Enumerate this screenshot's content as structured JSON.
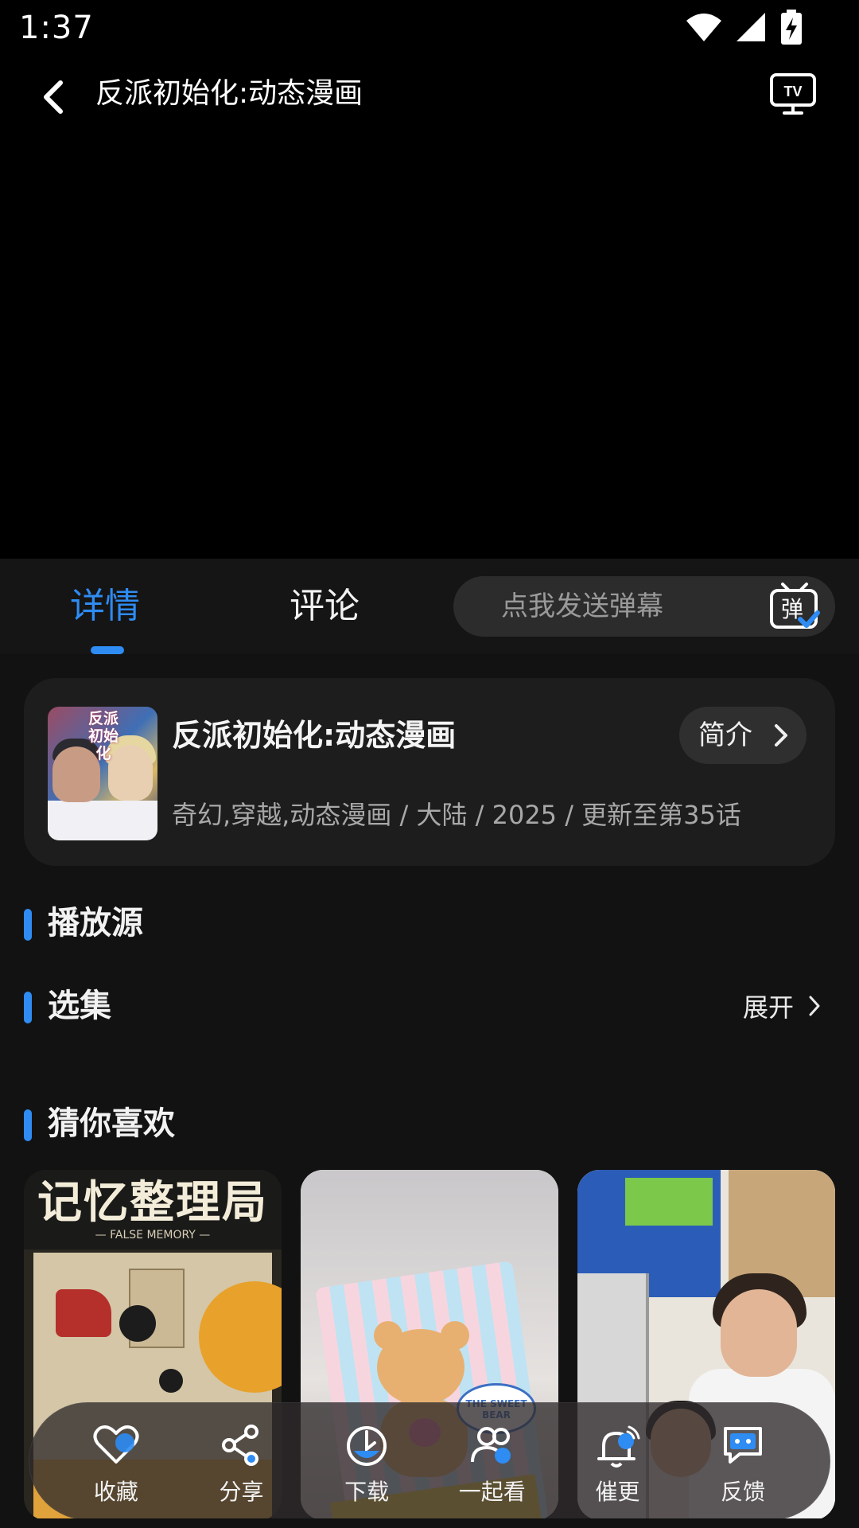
{
  "status_bar": {
    "time": "1:37"
  },
  "player": {
    "title": "反派初始化:动态漫画"
  },
  "tabs": [
    {
      "label": "详情",
      "active": true
    },
    {
      "label": "评论",
      "active": false
    }
  ],
  "danmaku": {
    "placeholder": "点我发送弹幕",
    "icon_text": "弹"
  },
  "info_card": {
    "poster_text": "反派初始化",
    "title": "反派初始化:动态漫画",
    "intro_button": "简介",
    "meta": "奇幻,穿越,动态漫画 / 大陆 / 2025 / 更新至第35话"
  },
  "sections": {
    "source": "播放源",
    "episodes": "选集",
    "expand": "展开",
    "recommend": "猜你喜欢"
  },
  "recommend": [
    {
      "cover_title": "记忆整理局",
      "cover_subtitle": "— FALSE MEMORY —"
    },
    {
      "cover_label": "THE SWEET BEAR"
    },
    {
      "cover_label": ""
    }
  ],
  "actions": [
    {
      "label": "收藏",
      "icon": "heart-icon"
    },
    {
      "label": "分享",
      "icon": "share-icon"
    },
    {
      "label": "下载",
      "icon": "download-icon"
    },
    {
      "label": "一起看",
      "icon": "watch-together-icon"
    },
    {
      "label": "催更",
      "icon": "bell-icon"
    },
    {
      "label": "反馈",
      "icon": "feedback-icon"
    }
  ],
  "colors": {
    "accent": "#2e8cf3",
    "background": "#121212",
    "card": "#1d1d1d"
  }
}
